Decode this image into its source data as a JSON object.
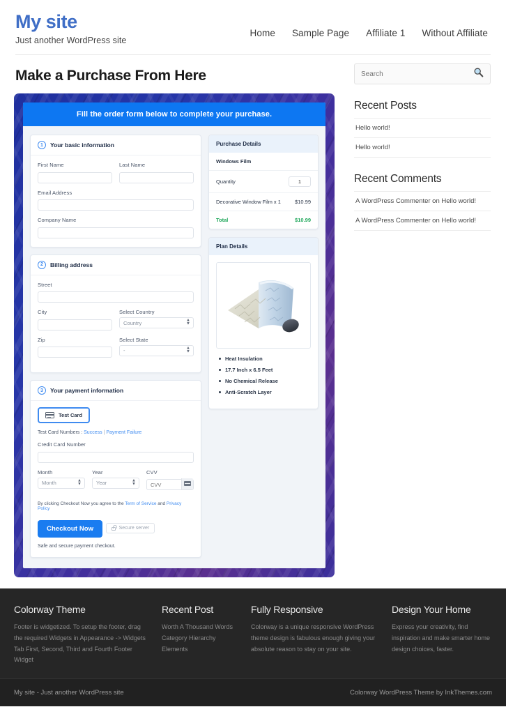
{
  "header": {
    "site_title": "My site",
    "tagline": "Just another WordPress site",
    "nav": [
      {
        "label": "Home"
      },
      {
        "label": "Sample Page"
      },
      {
        "label": "Affiliate 1"
      },
      {
        "label": "Without Affiliate"
      }
    ]
  },
  "main": {
    "page_title": "Make a Purchase From Here",
    "order_banner": "Fill the order form below to complete your purchase.",
    "basic_info": {
      "step": "1",
      "title": "Your basic information",
      "first_name_label": "First Name",
      "first_name_value": "",
      "last_name_label": "Last Name",
      "last_name_value": "",
      "email_label": "Email Address",
      "email_value": "",
      "company_label": "Company Name",
      "company_value": ""
    },
    "billing": {
      "step": "2",
      "title": "Billing address",
      "street_label": "Street",
      "street_value": "",
      "city_label": "City",
      "city_value": "",
      "country_label": "Select Country",
      "country_value": "Country",
      "zip_label": "Zip",
      "zip_value": "",
      "state_label": "Select State",
      "state_value": "-"
    },
    "payment": {
      "step": "3",
      "title": "Your payment information",
      "test_card_label": "Test Card",
      "test_numbers_prefix": "Test Card Numbers :",
      "success_link": "Success",
      "separator": "|",
      "failure_link": "Payment Failure",
      "cc_label": "Credit Card Number",
      "cc_value": "",
      "month_label": "Month",
      "month_value": "Month",
      "year_label": "Year",
      "year_value": "Year",
      "cvv_label": "CVV",
      "cvv_value": "CVV",
      "agree_prefix": "By clicking Checkout Now you agree to the",
      "terms_link": "Term of Service",
      "agree_mid": "and",
      "privacy_link": "Privacy Policy",
      "checkout_label": "Checkout Now",
      "secure_badge": "Secure server",
      "safe_note": "Safe and secure payment checkout."
    },
    "purchase_details": {
      "title": "Purchase Details",
      "product": "Windows Film",
      "quantity_label": "Quantity",
      "quantity_value": "1",
      "line_item_label": "Decorative Window Film x 1",
      "line_item_price": "$10.99",
      "total_label": "Total",
      "total_price": "$10.99"
    },
    "plan_details": {
      "title": "Plan Details",
      "features": [
        "Heat Insulation",
        "17.7 Inch x 6.5 Feet",
        "No Chemical Release",
        "Anti-Scratch Layer"
      ]
    }
  },
  "sidebar": {
    "search_placeholder": "Search",
    "search_value": "",
    "recent_posts_title": "Recent Posts",
    "recent_posts": [
      {
        "label": "Hello world!"
      },
      {
        "label": "Hello world!"
      }
    ],
    "recent_comments_title": "Recent Comments",
    "recent_comments": [
      {
        "label": "A WordPress Commenter on Hello world!"
      },
      {
        "label": "A WordPress Commenter on Hello world!"
      }
    ]
  },
  "footer": {
    "widgets": [
      {
        "title": "Colorway Theme",
        "text": "Footer is widgetized. To setup the footer, drag the required Widgets in Appearance -> Widgets Tab First, Second, Third and Fourth Footer Widget"
      },
      {
        "title": "Recent Post",
        "items": [
          {
            "label": "Worth A Thousand Words"
          },
          {
            "label": "Category Hierarchy"
          },
          {
            "label": "Elements"
          }
        ]
      },
      {
        "title": "Fully Responsive",
        "text": "Colorway is a unique responsive WordPress theme design is fabulous enough giving your absolute reason to stay on your site."
      },
      {
        "title": "Design Your Home",
        "text": "Express your creativity, find inspiration and make smarter home design choices, faster."
      }
    ],
    "copyright_left": "My site - Just another WordPress site",
    "copyright_right": "Colorway WordPress Theme by InkThemes.com"
  },
  "colors": {
    "brand_blue": "#3f6ec6",
    "accent_blue": "#0d77f2",
    "total_green": "#21a85c",
    "frame_dark": "#1f2f9e",
    "footer_dark": "#262626"
  }
}
